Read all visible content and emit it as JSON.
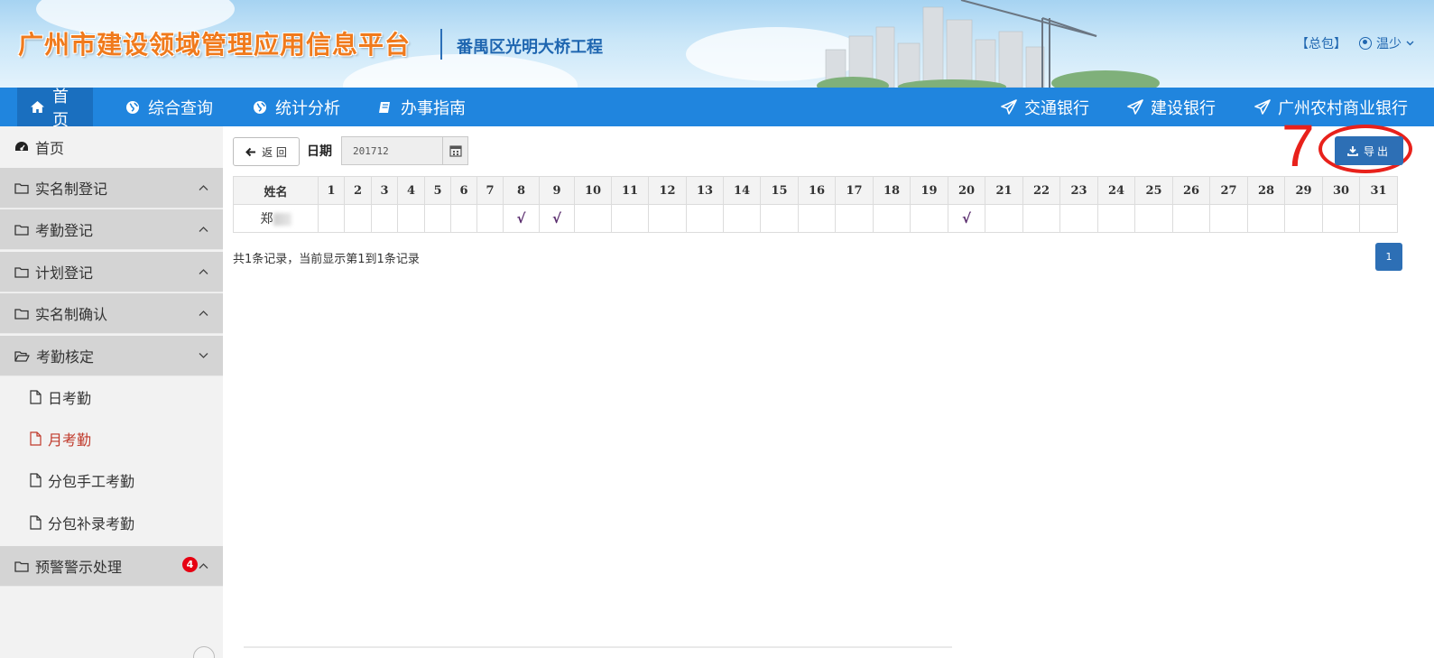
{
  "header": {
    "platform_title": "广州市建设领域管理应用信息平台",
    "project_name": "番禺区光明大桥工程",
    "role_tag": "【总包】",
    "username": "温少"
  },
  "nav": {
    "left": [
      {
        "label": "首页",
        "icon": "home-icon"
      },
      {
        "label": "综合查询",
        "icon": "globe-icon"
      },
      {
        "label": "统计分析",
        "icon": "globe-icon"
      },
      {
        "label": "办事指南",
        "icon": "book-icon"
      }
    ],
    "right": [
      {
        "label": "交通银行",
        "icon": "paper-plane-icon"
      },
      {
        "label": "建设银行",
        "icon": "paper-plane-icon"
      },
      {
        "label": "广州农村商业银行",
        "icon": "paper-plane-icon"
      }
    ]
  },
  "sidebar": {
    "home": "首页",
    "groups": [
      {
        "label": "实名制登记"
      },
      {
        "label": "考勤登记"
      },
      {
        "label": "计划登记"
      },
      {
        "label": "实名制确认"
      },
      {
        "label": "考勤核定"
      }
    ],
    "sub_items": [
      {
        "label": "日考勤"
      },
      {
        "label": "月考勤"
      },
      {
        "label": "分包手工考勤"
      },
      {
        "label": "分包补录考勤"
      }
    ],
    "warning": {
      "label": "预警警示处理",
      "badge": "4"
    }
  },
  "toolbar": {
    "back_label": "返 回",
    "date_label": "日期",
    "date_value": "201712",
    "export_label": "导出",
    "annotation_number": "7"
  },
  "table": {
    "name_header": "姓名",
    "days": [
      "1",
      "2",
      "3",
      "4",
      "5",
      "6",
      "7",
      "8",
      "9",
      "10",
      "11",
      "12",
      "13",
      "14",
      "15",
      "16",
      "17",
      "18",
      "19",
      "20",
      "21",
      "22",
      "23",
      "24",
      "25",
      "26",
      "27",
      "28",
      "29",
      "30",
      "31"
    ],
    "rows": [
      {
        "name": "郑",
        "present_days": [
          8,
          9,
          20
        ]
      }
    ]
  },
  "records_text": "共1条记录，当前显示第1到1条记录",
  "pagination": {
    "current": "1"
  },
  "colors": {
    "nav": "#2085de",
    "primary_button": "#2d6fb5",
    "annotation": "#e8211b",
    "title": "#f07a1c"
  }
}
